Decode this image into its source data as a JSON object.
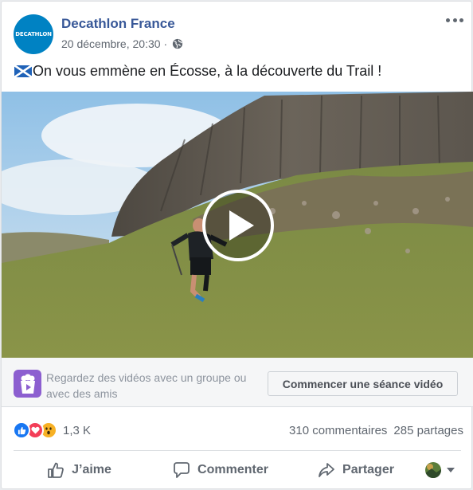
{
  "page": {
    "name": "Decathlon France",
    "logo_text": "DECATHLON",
    "date": "20 décembre, 20:30",
    "separator": "·"
  },
  "post": {
    "text": "On vous emmène en Écosse, à la découverte du Trail !",
    "flag_icon": "scotland-flag-icon"
  },
  "video": {
    "play_icon": "play-icon"
  },
  "watch_party": {
    "prompt": "Regardez des vidéos avec un groupe ou avec des amis",
    "button": "Commencer une séance vidéo"
  },
  "reactions": {
    "count": "1,3 K",
    "types": [
      "like",
      "love",
      "wow"
    ],
    "comments": "310 commentaires",
    "shares": "285 partages"
  },
  "actions": {
    "like": "J’aime",
    "comment": "Commenter",
    "share": "Partager"
  },
  "colors": {
    "brand": "#0082c3",
    "link": "#385898",
    "like_blue": "#1877f2",
    "love_red": "#f33e58",
    "wow_yellow": "#f7b125",
    "watch_purple": "#8c5fd0"
  }
}
